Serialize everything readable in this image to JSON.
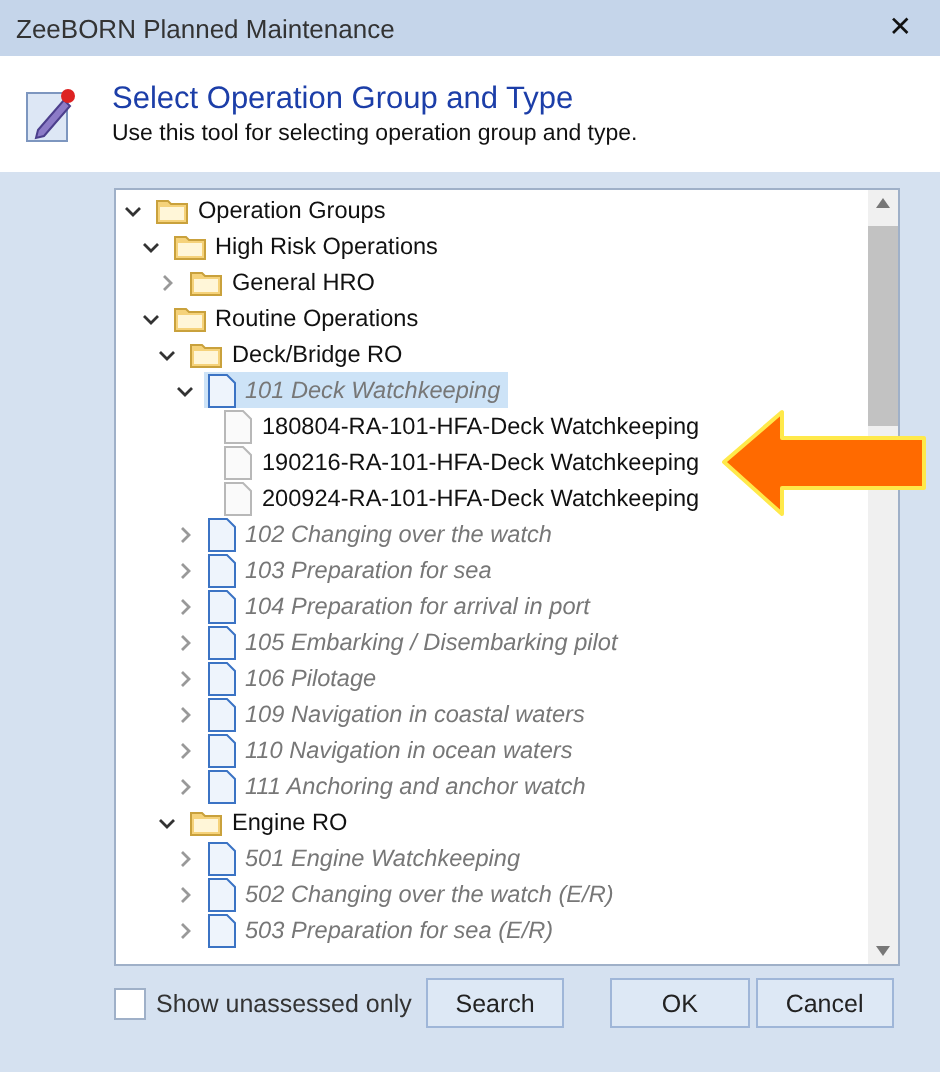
{
  "window": {
    "title": "ZeeBORN Planned Maintenance",
    "close": "✕"
  },
  "header": {
    "title": "Select Operation Group and Type",
    "subtitle": "Use this tool for selecting operation group and type."
  },
  "tree": [
    {
      "label": "Operation Groups",
      "kind": "folder",
      "expanded": true,
      "selected": false,
      "children": [
        {
          "label": "High Risk Operations",
          "kind": "folder",
          "expanded": true,
          "selected": false,
          "children": [
            {
              "label": "General HRO",
              "kind": "folder",
              "expanded": false,
              "selected": false
            }
          ]
        },
        {
          "label": "Routine Operations",
          "kind": "folder",
          "expanded": true,
          "selected": false,
          "children": [
            {
              "label": "Deck/Bridge RO",
              "kind": "folder",
              "expanded": true,
              "selected": false,
              "children": [
                {
                  "label": "101 Deck Watchkeeping",
                  "kind": "operation",
                  "expanded": true,
                  "selected": true,
                  "children": [
                    {
                      "label": "180804-RA-101-HFA-Deck Watchkeeping",
                      "kind": "record",
                      "selected": false
                    },
                    {
                      "label": "190216-RA-101-HFA-Deck Watchkeeping",
                      "kind": "record",
                      "selected": false
                    },
                    {
                      "label": "200924-RA-101-HFA-Deck Watchkeeping",
                      "kind": "record",
                      "selected": false
                    }
                  ]
                },
                {
                  "label": "102 Changing over the watch",
                  "kind": "operation",
                  "expanded": false,
                  "selected": false
                },
                {
                  "label": "103 Preparation for sea",
                  "kind": "operation",
                  "expanded": false,
                  "selected": false
                },
                {
                  "label": "104 Preparation for arrival in port",
                  "kind": "operation",
                  "expanded": false,
                  "selected": false
                },
                {
                  "label": "105 Embarking / Disembarking pilot",
                  "kind": "operation",
                  "expanded": false,
                  "selected": false
                },
                {
                  "label": "106 Pilotage",
                  "kind": "operation",
                  "expanded": false,
                  "selected": false
                },
                {
                  "label": "109 Navigation in coastal waters",
                  "kind": "operation",
                  "expanded": false,
                  "selected": false
                },
                {
                  "label": "110 Navigation in ocean waters",
                  "kind": "operation",
                  "expanded": false,
                  "selected": false
                },
                {
                  "label": "111 Anchoring and anchor watch",
                  "kind": "operation",
                  "expanded": false,
                  "selected": false
                }
              ]
            },
            {
              "label": "Engine RO",
              "kind": "folder",
              "expanded": true,
              "selected": false,
              "children": [
                {
                  "label": "501 Engine Watchkeeping",
                  "kind": "operation",
                  "expanded": false,
                  "selected": false
                },
                {
                  "label": "502 Changing over the watch (E/R)",
                  "kind": "operation",
                  "expanded": false,
                  "selected": false
                },
                {
                  "label": "503 Preparation for sea (E/R)",
                  "kind": "operation",
                  "expanded": false,
                  "selected": false
                }
              ]
            }
          ]
        }
      ]
    }
  ],
  "show_unassessed_only": {
    "label": "Show unassessed only",
    "checked": false
  },
  "buttons": [
    "Search",
    "OK",
    "Cancel"
  ]
}
